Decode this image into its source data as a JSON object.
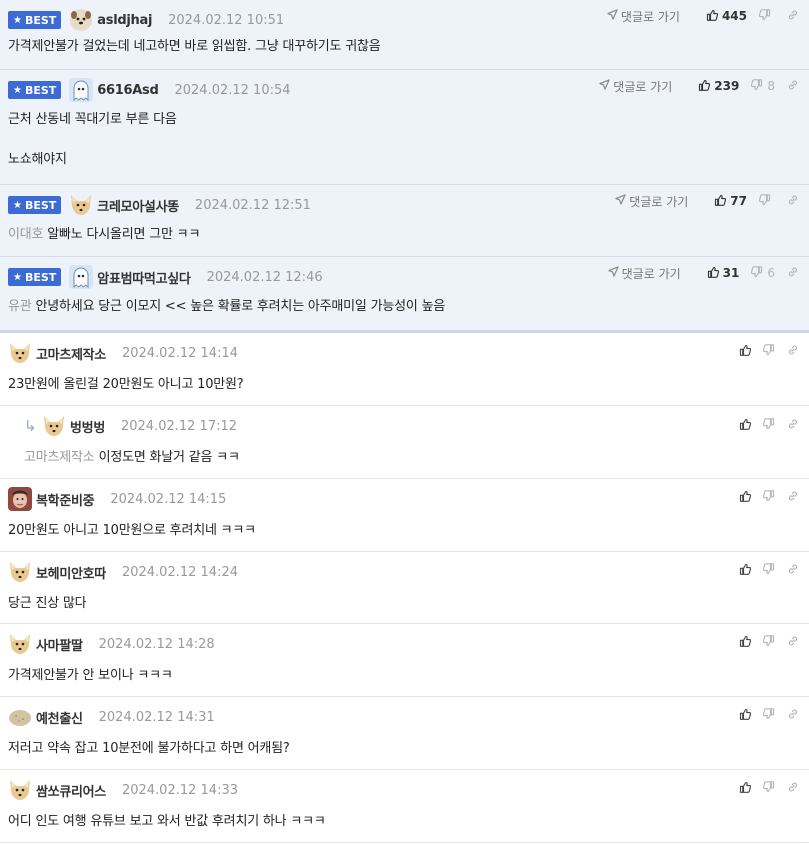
{
  "labels": {
    "best": "BEST",
    "goto_reply": "댓글로 가기"
  },
  "best_comments": [
    {
      "nick": "asldjhaj",
      "date": "2024.02.12 10:51",
      "text": "가격제안불가 걸었는데 네고하면 바로 읽씹함. 그냥 대꾸하기도 귀찮음",
      "mention": "",
      "up": "445",
      "down": "",
      "avatar": "dog"
    },
    {
      "nick": "6616Asd",
      "date": "2024.02.12 10:54",
      "text": "근처 산동네 꼭대기로 부른 다음\n\n노쇼해야지",
      "mention": "",
      "up": "239",
      "down": "8",
      "avatar": "ghost"
    },
    {
      "nick": "크레모아설사똥",
      "date": "2024.02.12 12:51",
      "text": "알빠노 다시올리면 그만 ㅋㅋ",
      "mention": "이대호",
      "up": "77",
      "down": "",
      "avatar": "fox"
    },
    {
      "nick": "암표범따먹고싶다",
      "date": "2024.02.12 12:46",
      "text": "안녕하세요 당근 이모지 << 높은 확률로 후려치는 아주매미일 가능성이 높음",
      "mention": "유관",
      "up": "31",
      "down": "6",
      "avatar": "ghost"
    }
  ],
  "comments": [
    {
      "nick": "고마츠제작소",
      "date": "2024.02.12 14:14",
      "text": "23만원에 올린걸 20만원도 아니고 10만원?",
      "mention": "",
      "reply": false,
      "avatar": "fox"
    },
    {
      "nick": "벙벙벙",
      "date": "2024.02.12 17:12",
      "text": "이정도면 화날거 같음 ㅋㅋ",
      "mention": "고마츠제작소",
      "reply": true,
      "avatar": "fox"
    },
    {
      "nick": "복학준비중",
      "date": "2024.02.12 14:15",
      "text": "20만원도 아니고 10만원으로 후려치네 ㅋㅋㅋ",
      "mention": "",
      "reply": false,
      "avatar": "photo"
    },
    {
      "nick": "보헤미안호따",
      "date": "2024.02.12 14:24",
      "text": "당근 진상 많다",
      "mention": "",
      "reply": false,
      "avatar": "fox"
    },
    {
      "nick": "사마팔딸",
      "date": "2024.02.12 14:28",
      "text": "가격제안불가 안 보이나 ㅋㅋㅋ",
      "mention": "",
      "reply": false,
      "avatar": "fox"
    },
    {
      "nick": "예천출신",
      "date": "2024.02.12 14:31",
      "text": "저러고 약속 잡고 10분전에 불가하다고 하면 어캐됨?",
      "mention": "",
      "reply": false,
      "avatar": "potato"
    },
    {
      "nick": "쌈쏘큐리어스",
      "date": "2024.02.12 14:33",
      "text": "어디 인도 여행 유튜브 보고 와서 반값 후려치기 하나 ㅋㅋㅋ",
      "mention": "",
      "reply": false,
      "avatar": "fox"
    }
  ],
  "colors": {
    "best_badge": "#3d6bd6",
    "best_bg": "#eef2f9",
    "date": "#999999",
    "mention": "#999999"
  },
  "icons": {
    "goto": "paper-plane-icon",
    "up": "thumbs-up-icon",
    "down": "thumbs-down-icon",
    "link": "link-icon",
    "reply_arrow": "reply-arrow-icon",
    "best_star": "star-icon"
  }
}
